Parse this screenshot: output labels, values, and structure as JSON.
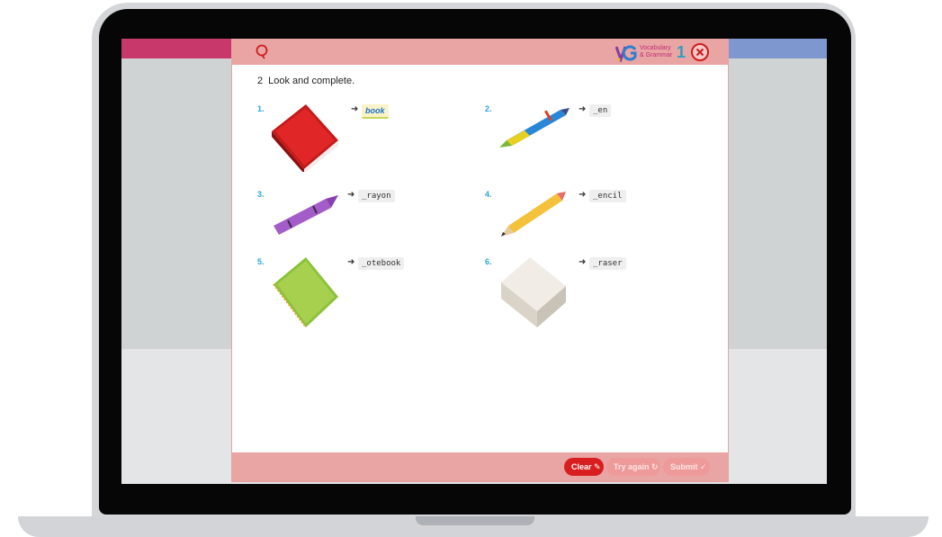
{
  "header": {
    "logo_letters": "VG",
    "logo_line1": "Vocabulary",
    "logo_line2": "& Grammar",
    "logo_level": "1"
  },
  "exercise": {
    "number": "2",
    "instruction": "Look and complete."
  },
  "items": [
    {
      "num": "1.",
      "answer": "book",
      "image": "red-book"
    },
    {
      "num": "2.",
      "answer": "_en",
      "image": "pen"
    },
    {
      "num": "3.",
      "answer": "_rayon",
      "image": "purple-crayon"
    },
    {
      "num": "4.",
      "answer": "_encil",
      "image": "pencil"
    },
    {
      "num": "5.",
      "answer": "_otebook",
      "image": "green-notebook"
    },
    {
      "num": "6.",
      "answer": "_raser",
      "image": "eraser"
    }
  ],
  "arrow": "➜",
  "footer": {
    "clear_label": "Clear",
    "try_again_label": "Try again",
    "submit_label": "Submit"
  },
  "colors": {
    "header_bg": "#e9a4a4",
    "item_number": "#2aa7d2",
    "clear_button": "#d81e1e"
  }
}
